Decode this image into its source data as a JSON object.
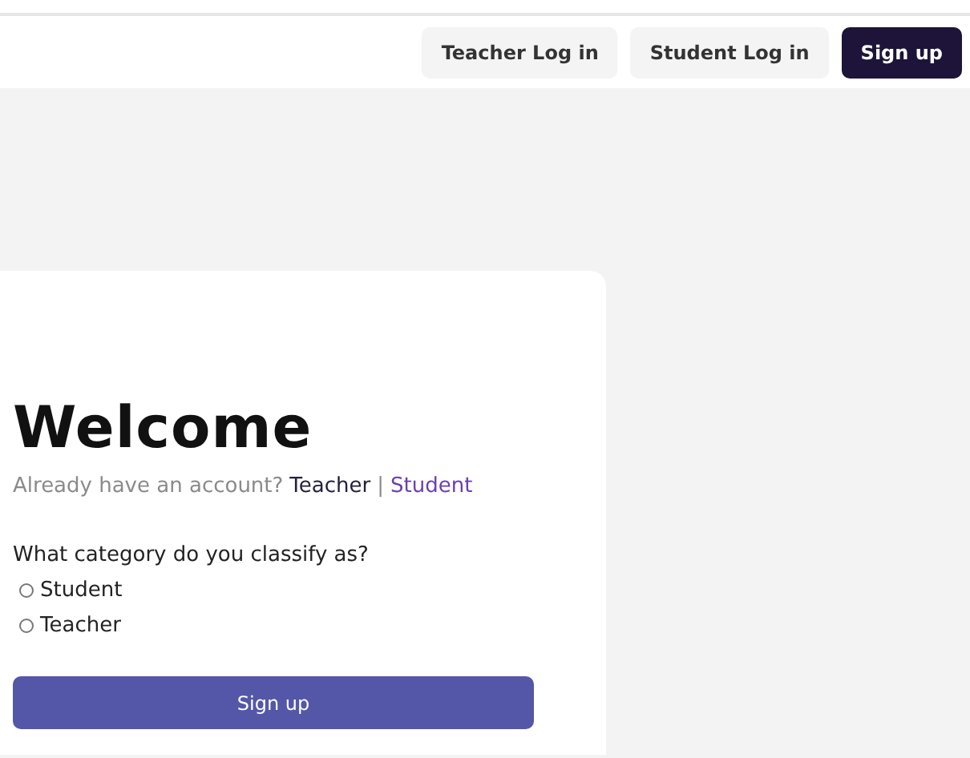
{
  "header": {
    "buttons": [
      {
        "label": "Teacher Log in",
        "kind": "plain"
      },
      {
        "label": "Student Log in",
        "kind": "plain"
      },
      {
        "label": "Sign up",
        "kind": "primary"
      }
    ]
  },
  "card": {
    "title": "Welcome",
    "account_prompt": "Already have an account?",
    "login_links": [
      {
        "label": "Teacher",
        "kind": "dark"
      },
      {
        "label": "Student",
        "kind": "purple"
      }
    ],
    "separator": "|",
    "question": "What category do you classify as?",
    "options": [
      {
        "label": "Student",
        "selected": false
      },
      {
        "label": "Teacher",
        "selected": false
      }
    ],
    "submit": "Sign up"
  }
}
